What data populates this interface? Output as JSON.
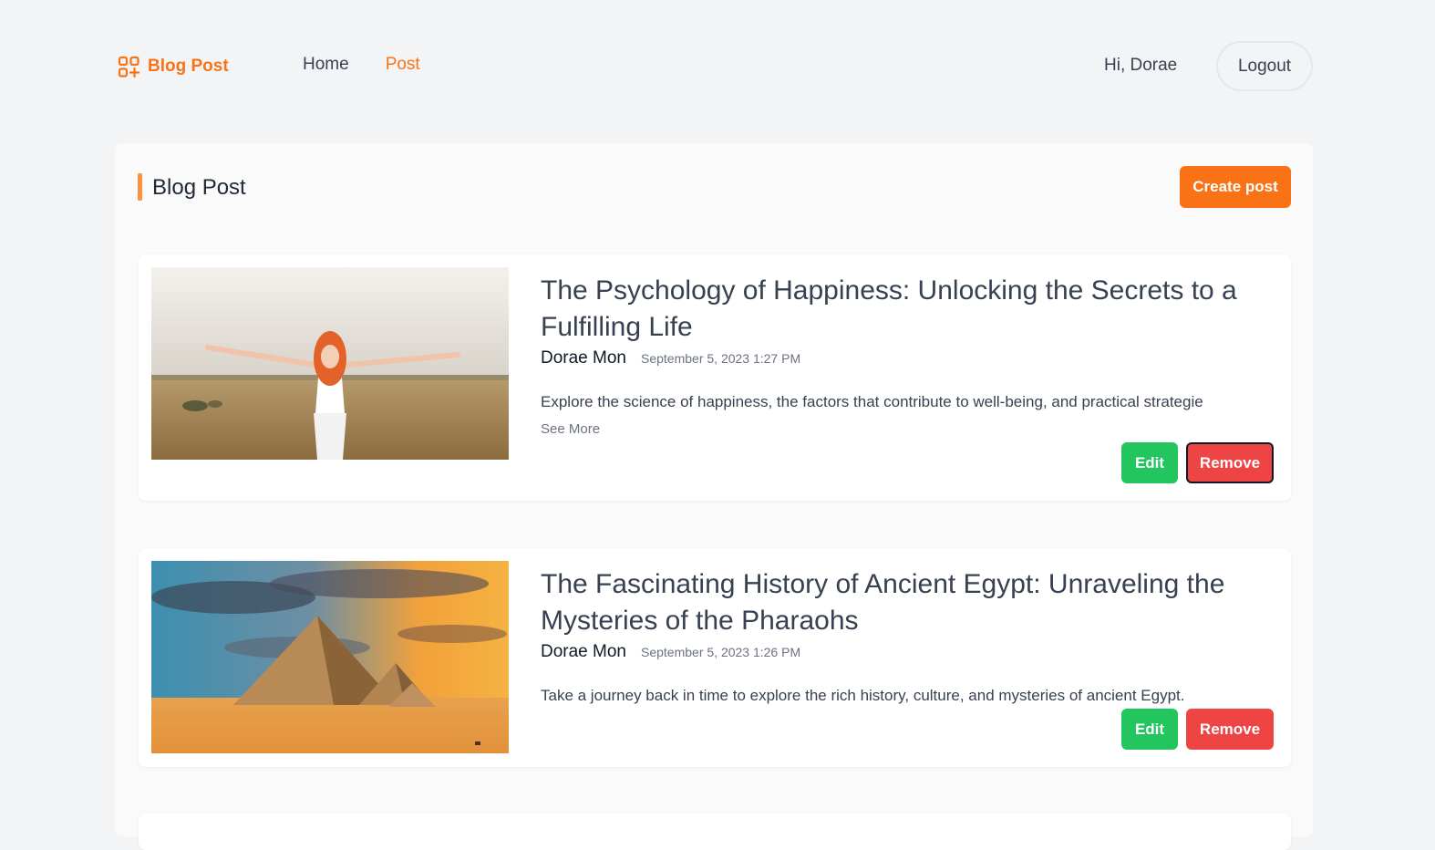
{
  "brand": {
    "name": "Blog Post",
    "icon": "apps-grid-plus-icon"
  },
  "nav": [
    {
      "label": "Home",
      "active": false
    },
    {
      "label": "Post",
      "active": true
    }
  ],
  "user": {
    "greeting": "Hi, Dorae",
    "logout_label": "Logout"
  },
  "panel": {
    "title": "Blog Post",
    "create_label": "Create post"
  },
  "posts": [
    {
      "title": "The Psychology of Happiness: Unlocking the Secrets to a Fulfilling Life",
      "author": "Dorae Mon",
      "date": "September 5, 2023 1:27 PM",
      "excerpt": "Explore the science of happiness, the factors that contribute to well-being, and practical strategie",
      "see_more": "See More",
      "edit_label": "Edit",
      "remove_label": "Remove",
      "image": "woman-in-wheat-field-photo"
    },
    {
      "title": "The Fascinating History of Ancient Egypt: Unraveling the Mysteries of the Pharaohs",
      "author": "Dorae Mon",
      "date": "September 5, 2023 1:26 PM",
      "excerpt": "Take a journey back in time to explore the rich history, culture, and mysteries of ancient Egypt.",
      "edit_label": "Edit",
      "remove_label": "Remove",
      "image": "pyramids-at-sunset-photo"
    }
  ],
  "colors": {
    "accent": "#f97316",
    "edit": "#22c55e",
    "remove": "#ef4444",
    "background": "#f3f4f6"
  }
}
